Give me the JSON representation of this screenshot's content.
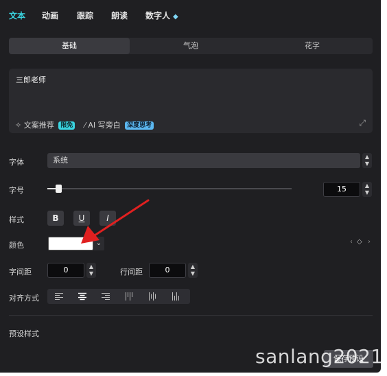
{
  "tabs": [
    {
      "label": "文本",
      "active": true
    },
    {
      "label": "动画",
      "active": false
    },
    {
      "label": "跟踪",
      "active": false
    },
    {
      "label": "朗读",
      "active": false
    },
    {
      "label": "数字人",
      "active": false,
      "icon": "diamond-icon"
    }
  ],
  "subtabs": [
    {
      "label": "基础",
      "active": true
    },
    {
      "label": "气泡",
      "active": false
    },
    {
      "label": "花字",
      "active": false
    }
  ],
  "text_editor": {
    "content": "三郎老师",
    "recommend_label": "文案推荐",
    "recommend_badge": "限免",
    "ai_label": "AI 写旁白",
    "ai_badge": "深度思考"
  },
  "font": {
    "label": "字体",
    "value": "系统"
  },
  "size": {
    "label": "字号",
    "value": "15",
    "slider_fraction": 0.045
  },
  "style": {
    "label": "样式",
    "bold": "B",
    "underline": "U",
    "italic": "I"
  },
  "color": {
    "label": "颜色",
    "value": "#ffffff"
  },
  "letter_spacing": {
    "label": "字间距",
    "value": "0"
  },
  "line_spacing": {
    "label": "行间距",
    "value": "0"
  },
  "alignment": {
    "label": "对齐方式"
  },
  "preset": {
    "label": "预设样式",
    "save_label": "保存预设"
  },
  "watermark": "sanlang2021",
  "colors": {
    "accent": "#3ad4e0",
    "panel": "#1f1f22"
  }
}
